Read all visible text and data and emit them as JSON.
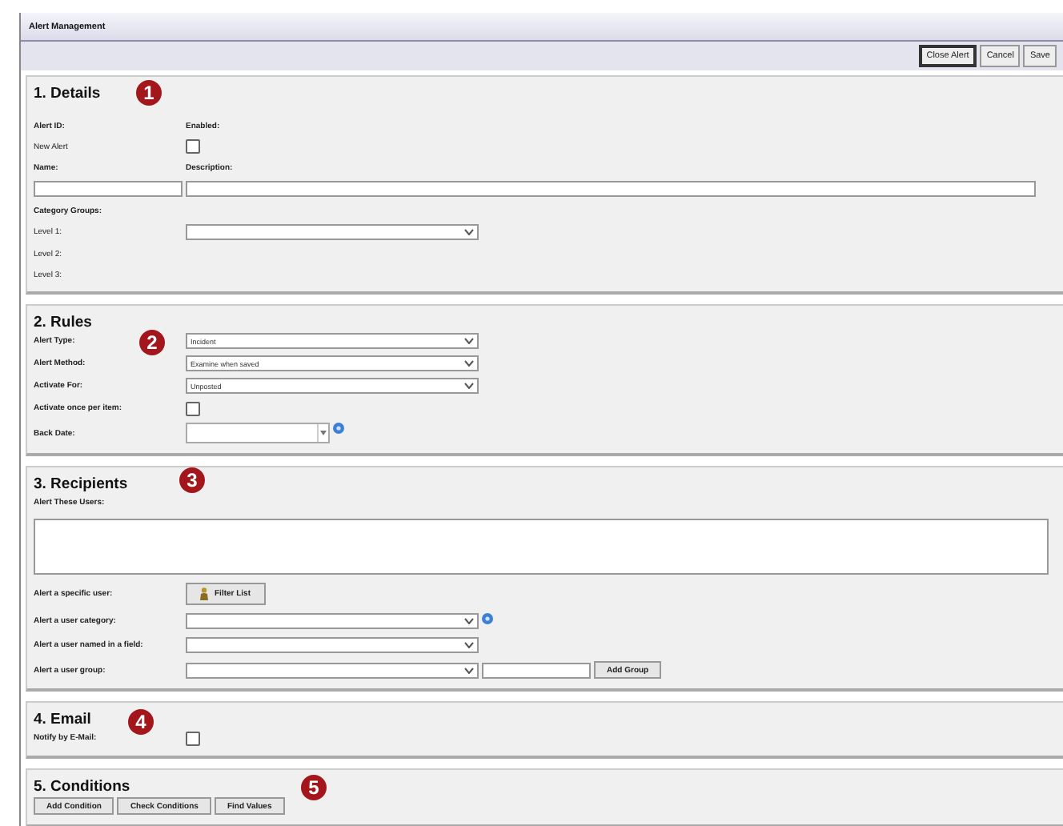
{
  "window": {
    "title": "Alert Management"
  },
  "toolbar": [
    {
      "label": "Close Alert",
      "primary": true
    },
    {
      "label": "Cancel",
      "primary": false
    },
    {
      "label": "Save",
      "primary": false
    }
  ],
  "sections": [
    {
      "title": "1. Details",
      "badge": "1",
      "rows": [
        {
          "cells": [
            {
              "kind": "label",
              "text": "Alert ID:"
            },
            {
              "kind": "label",
              "text": "Enabled:"
            }
          ]
        },
        {
          "cells": [
            {
              "kind": "text",
              "text": "New Alert"
            },
            {
              "kind": "checkbox",
              "checked": false
            }
          ]
        },
        {
          "cells": [
            {
              "kind": "label",
              "text": "Name:"
            },
            {
              "kind": "label",
              "text": "Description:"
            }
          ]
        },
        {
          "cells": [
            {
              "kind": "field"
            },
            {
              "kind": "wide-field"
            }
          ]
        },
        {
          "cells": [
            {
              "kind": "label",
              "text": "Category Groups:"
            }
          ]
        },
        {
          "cells": [
            {
              "kind": "text",
              "text": "Level 1:"
            },
            {
              "kind": "select"
            }
          ]
        },
        {
          "cells": [
            {
              "kind": "text",
              "text": "Level 2:"
            }
          ]
        },
        {
          "cells": [
            {
              "kind": "text",
              "text": "Level 3:"
            }
          ]
        }
      ]
    },
    {
      "title": "2. Rules",
      "badge": "2",
      "rows": [
        {
          "cells": [
            {
              "kind": "label",
              "text": "Alert Type:"
            },
            {
              "kind": "select",
              "value": "Incident"
            }
          ]
        },
        {
          "cells": [
            {
              "kind": "label",
              "text": "Alert Method:"
            },
            {
              "kind": "select",
              "value": "Examine when saved"
            }
          ]
        },
        {
          "cells": [
            {
              "kind": "label",
              "text": "Activate For:"
            },
            {
              "kind": "select",
              "value": "Unposted"
            }
          ]
        },
        {
          "cells": [
            {
              "kind": "label",
              "text": "Activate once per item:"
            },
            {
              "kind": "checkbox",
              "checked": false
            }
          ]
        },
        {
          "cells": [
            {
              "kind": "label",
              "text": "Back Date:"
            },
            {
              "kind": "date"
            },
            {
              "kind": "help"
            }
          ]
        }
      ]
    },
    {
      "title": "3. Recipients",
      "badge": "3",
      "rows": [
        {
          "cells": [
            {
              "kind": "label",
              "text": "Alert These Users:"
            }
          ]
        },
        {
          "cells": [
            {
              "kind": "textarea"
            }
          ]
        },
        {
          "cells": [
            {
              "kind": "label",
              "text": "Alert a specific user:"
            },
            {
              "kind": "icon-button",
              "text": "Filter List"
            }
          ]
        },
        {
          "cells": [
            {
              "kind": "label",
              "text": "Alert a user category:"
            },
            {
              "kind": "select"
            },
            {
              "kind": "help"
            }
          ]
        },
        {
          "cells": [
            {
              "kind": "label",
              "text": "Alert a user named in a field:"
            },
            {
              "kind": "select"
            }
          ]
        },
        {
          "cells": [
            {
              "kind": "label",
              "text": "Alert a user group:"
            },
            {
              "kind": "select"
            },
            {
              "kind": "field"
            },
            {
              "kind": "button",
              "text": "Add Group"
            }
          ]
        }
      ]
    },
    {
      "title": "4. Email",
      "badge": "4",
      "rows": [
        {
          "cells": [
            {
              "kind": "label",
              "text": "Notify by E-Mail:"
            },
            {
              "kind": "checkbox",
              "checked": false
            }
          ]
        }
      ]
    },
    {
      "title": "5. Conditions",
      "badge": "5",
      "rows": [
        {
          "cells": [
            {
              "kind": "button",
              "text": "Add Condition"
            },
            {
              "kind": "button",
              "text": "Check Conditions"
            },
            {
              "kind": "button",
              "text": "Find Values"
            }
          ]
        }
      ]
    }
  ]
}
